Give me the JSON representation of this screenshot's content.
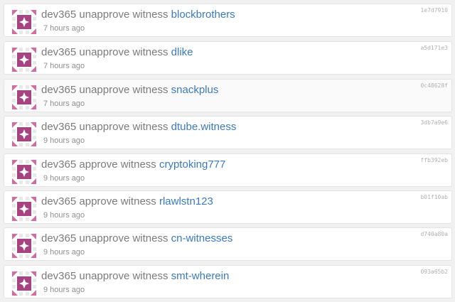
{
  "colors": {
    "link": "#3b7abf",
    "action_text": "#7b7b7b",
    "timestamp": "#8f8f8f",
    "txid": "#b0b0b0",
    "avatar_fill": "#a64380",
    "avatar_corner": "#d36c9e",
    "avatar_tile": "#e8e8e8"
  },
  "avatar_icon": "identicon-sparkle-icon",
  "feed": {
    "items": [
      {
        "actor": "dev365",
        "action": "unapprove witness",
        "target": "blockbrothers",
        "time": "7 hours ago",
        "txid": "1e7d7910"
      },
      {
        "actor": "dev365",
        "action": "unapprove witness",
        "target": "dlike",
        "time": "7 hours ago",
        "txid": "a5d171e3"
      },
      {
        "actor": "dev365",
        "action": "unapprove witness",
        "target": "snackplus",
        "time": "7 hours ago",
        "txid": "0c48628f"
      },
      {
        "actor": "dev365",
        "action": "unapprove witness",
        "target": "dtube.witness",
        "time": "9 hours ago",
        "txid": "3db7a9e6"
      },
      {
        "actor": "dev365",
        "action": "approve witness",
        "target": "cryptoking777",
        "time": "9 hours ago",
        "txid": "ffb392eb"
      },
      {
        "actor": "dev365",
        "action": "approve witness",
        "target": "rlawlstn123",
        "time": "9 hours ago",
        "txid": "b01f10ab"
      },
      {
        "actor": "dev365",
        "action": "unapprove witness",
        "target": "cn-witnesses",
        "time": "9 hours ago",
        "txid": "d740a80a"
      },
      {
        "actor": "dev365",
        "action": "unapprove witness",
        "target": "smt-wherein",
        "time": "9 hours ago",
        "txid": "093a65b2"
      }
    ]
  }
}
